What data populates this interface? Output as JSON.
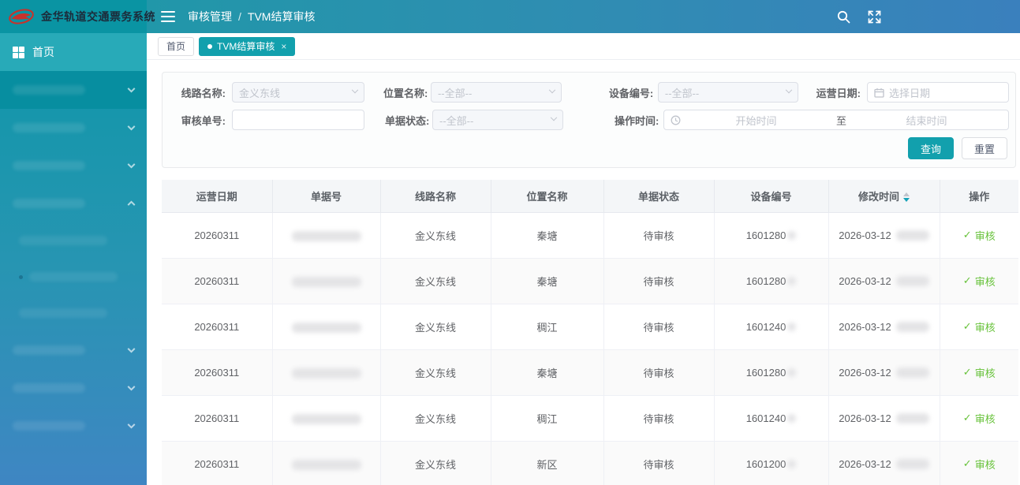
{
  "app": {
    "title": "金华轨道交通票务系统"
  },
  "topbar": {
    "breadcrumb": [
      "审核管理",
      "TVM结算审核"
    ],
    "breadcrumb_separator": "/"
  },
  "tabs": [
    {
      "label": "首页",
      "active": false
    },
    {
      "label": "TVM结算审核",
      "active": true,
      "close": "×"
    }
  ],
  "sidebar": {
    "home_label": "首页",
    "redacted_group_count": 7,
    "redacted_submenu_count": 3
  },
  "filters": {
    "line_name": {
      "label": "线路名称:",
      "value": "金义东线"
    },
    "location_name": {
      "label": "位置名称:",
      "placeholder": "--全部--"
    },
    "device_no": {
      "label": "设备编号:",
      "placeholder": "--全部--"
    },
    "operate_date": {
      "label": "运营日期:",
      "placeholder": "选择日期"
    },
    "audit_no": {
      "label": "审核单号:",
      "value": ""
    },
    "doc_status": {
      "label": "单据状态:",
      "placeholder": "--全部--"
    },
    "operate_time": {
      "label": "操作时间:",
      "start_placeholder": "开始时间",
      "separator": "至",
      "end_placeholder": "结束时间"
    },
    "search_button": "查询",
    "reset_button": "重置"
  },
  "table": {
    "columns": [
      "运营日期",
      "单据号",
      "线路名称",
      "位置名称",
      "单据状态",
      "设备编号",
      "修改时间",
      "操作"
    ],
    "sorted_column": "修改时间",
    "sort_state": "descending",
    "action_check": "✓",
    "action_label": "审核",
    "rows": [
      {
        "operate_date": "20260311",
        "line": "金义东线",
        "location": "秦塘",
        "status": "待审核",
        "device": "1601280",
        "modified": "2026-03-12"
      },
      {
        "operate_date": "20260311",
        "line": "金义东线",
        "location": "秦塘",
        "status": "待审核",
        "device": "1601280",
        "modified": "2026-03-12"
      },
      {
        "operate_date": "20260311",
        "line": "金义东线",
        "location": "稠江",
        "status": "待审核",
        "device": "1601240",
        "modified": "2026-03-12"
      },
      {
        "operate_date": "20260311",
        "line": "金义东线",
        "location": "秦塘",
        "status": "待审核",
        "device": "1601280",
        "modified": "2026-03-12"
      },
      {
        "operate_date": "20260311",
        "line": "金义东线",
        "location": "稠江",
        "status": "待审核",
        "device": "1601240",
        "modified": "2026-03-12"
      },
      {
        "operate_date": "20260311",
        "line": "金义东线",
        "location": "新区",
        "status": "待审核",
        "device": "1601200",
        "modified": "2026-03-12"
      }
    ]
  },
  "colors": {
    "primary_teal": "#12a0ad",
    "topbar_gradient": [
      "#2197a9",
      "#3a80bd"
    ],
    "sidebar_gradient": [
      "#0b97a7",
      "#3f86c3"
    ],
    "logo_bar": "#0a94a3",
    "action_green": "#67c23a",
    "logo_red": "#c8322b"
  }
}
